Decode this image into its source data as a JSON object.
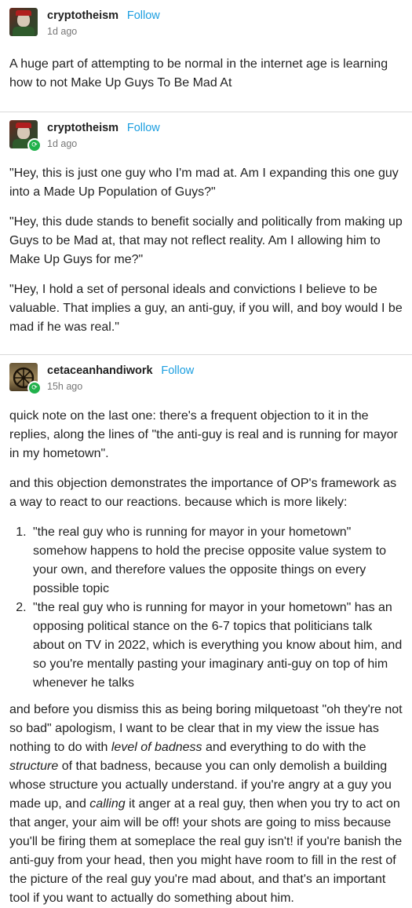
{
  "posts": [
    {
      "username": "cryptotheism",
      "follow_label": "Follow",
      "time": "1d ago",
      "paragraphs": [
        "A huge part of attempting to be normal in the internet age is learning how to not Make Up Guys To Be Mad At"
      ]
    },
    {
      "username": "cryptotheism",
      "follow_label": "Follow",
      "time": "1d ago",
      "paragraphs": [
        "\"Hey, this is just one guy who I'm mad at. Am I expanding this one guy into a Made Up Population of Guys?\"",
        "\"Hey, this dude stands to benefit socially and politically from making up Guys to be Mad at, that may not reflect reality. Am I allowing him to Make Up Guys for me?\"",
        "\"Hey, I hold a set of personal ideals and convictions I believe to be valuable. That implies a guy, an anti-guy, if you will, and boy would I be mad if he was real.\""
      ]
    },
    {
      "username": "cetaceanhandiwork",
      "follow_label": "Follow",
      "time": "15h ago",
      "paragraphs": [
        "quick note on the last one: there's a frequent objection to it in the replies, along the lines of \"the anti-guy is real and is running for mayor in my hometown\".",
        "and this objection demonstrates the importance of OP's framework as a way to react to our reactions. because which is more likely:"
      ],
      "list": [
        "\"the real guy who is running for mayor in your hometown\" somehow happens to hold the precise opposite value system to your own, and therefore values the opposite things on every possible topic",
        "\"the real guy who is running for mayor in your hometown\" has an opposing political stance on the 6-7 topics that politicians talk about on TV in 2022, which is everything you know about him, and so you're mentally pasting your imaginary anti-guy on top of him whenever he talks"
      ],
      "closing": {
        "t1": "and before you dismiss this as being boring milquetoast \"oh they're not so bad\" apologism, I want to be clear that in my view the issue has nothing to do with ",
        "em1": "level of badness",
        "t2": " and everything to do with the ",
        "em2": "structure",
        "t3": " of that badness, because you can only demolish a building whose structure you actually understand. if you're angry at a guy you made up, and ",
        "em3": "calling",
        "t4": " it anger at a real guy, then when you try to act on that anger, your aim will be off! your shots are going to miss because you'll be firing them at someplace the real guy isn't! if you're banish the anti-guy from your head, then you might have room to fill in the rest of the picture of the real guy you're mad about, and that's an important tool if you want to actually do something about him."
      }
    }
  ],
  "icons": {
    "reblog": "reblog-icon"
  },
  "colors": {
    "follow": "#1b9ee0",
    "reblog_badge": "#20b14b"
  }
}
